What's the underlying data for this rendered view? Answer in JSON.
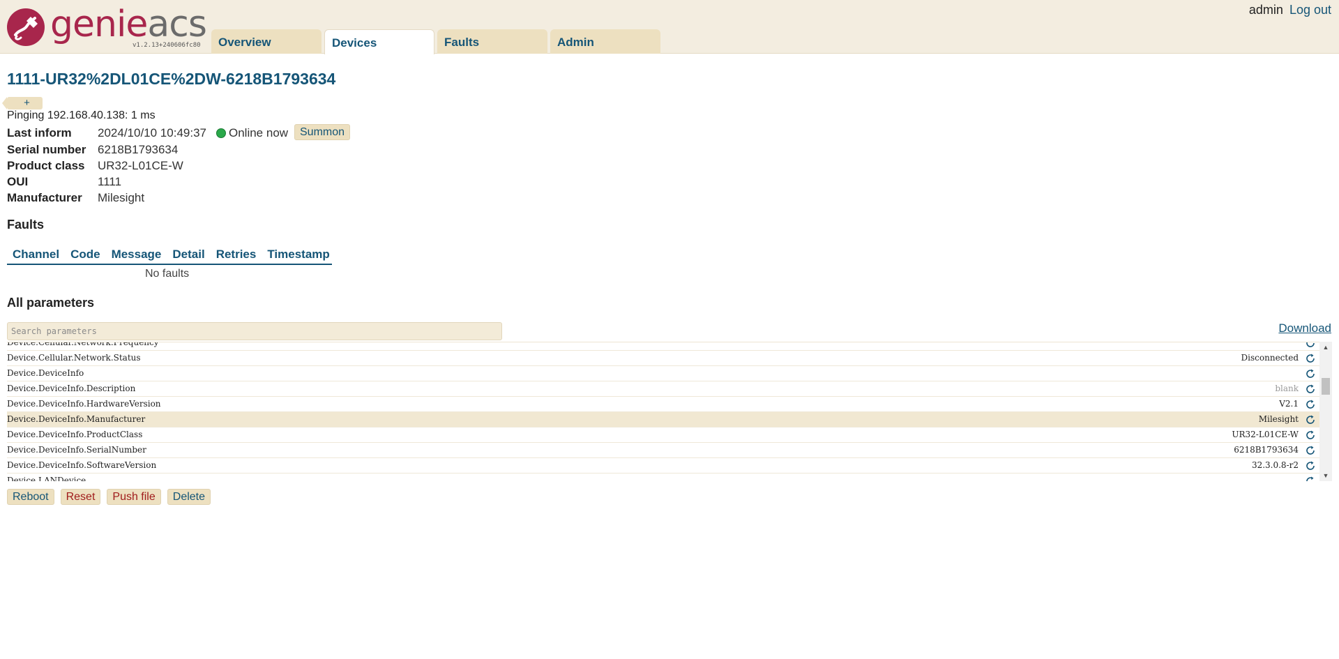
{
  "app": {
    "logo_prefix": "genie",
    "logo_suffix": "acs",
    "version": "v1.2.13+240606fc80"
  },
  "nav": {
    "tabs": [
      {
        "label": "Overview",
        "active": false
      },
      {
        "label": "Devices",
        "active": true
      },
      {
        "label": "Faults",
        "active": false
      },
      {
        "label": "Admin",
        "active": false
      }
    ]
  },
  "user": {
    "name": "admin",
    "logout_label": "Log out"
  },
  "device": {
    "title": "1111-UR32%2DL01CE%2DW-6218B1793634",
    "tag_add_label": "+",
    "ping": "Pinging 192.168.40.138: 1 ms",
    "last_inform_label": "Last inform",
    "last_inform_value": "2024/10/10 10:49:37",
    "online_status": "Online now",
    "summon_label": "Summon",
    "serial_label": "Serial number",
    "serial_value": "6218B1793634",
    "product_class_label": "Product class",
    "product_class_value": "UR32-L01CE-W",
    "oui_label": "OUI",
    "oui_value": "1111",
    "manufacturer_label": "Manufacturer",
    "manufacturer_value": "Milesight"
  },
  "faults": {
    "title": "Faults",
    "columns": [
      "Channel",
      "Code",
      "Message",
      "Detail",
      "Retries",
      "Timestamp"
    ],
    "empty_text": "No faults"
  },
  "parameters": {
    "title": "All parameters",
    "search_placeholder": "Search parameters",
    "download_label": "Download",
    "rows": [
      {
        "name": "Device.Cellular.Network.Frequency",
        "value": ""
      },
      {
        "name": "Device.Cellular.Network.Status",
        "value": "Disconnected"
      },
      {
        "name": "Device.DeviceInfo",
        "value": ""
      },
      {
        "name": "Device.DeviceInfo.Description",
        "value": "blank"
      },
      {
        "name": "Device.DeviceInfo.HardwareVersion",
        "value": "V2.1"
      },
      {
        "name": "Device.DeviceInfo.Manufacturer",
        "value": "Milesight"
      },
      {
        "name": "Device.DeviceInfo.ProductClass",
        "value": "UR32-L01CE-W"
      },
      {
        "name": "Device.DeviceInfo.SerialNumber",
        "value": "6218B1793634"
      },
      {
        "name": "Device.DeviceInfo.SoftwareVersion",
        "value": "32.3.0.8-r2"
      },
      {
        "name": "Device.LANDevice",
        "value": ""
      }
    ]
  },
  "actions": {
    "reboot": "Reboot",
    "reset": "Reset",
    "push_file": "Push file",
    "delete": "Delete"
  },
  "colors": {
    "header_bg": "#f3ede0",
    "brand": "#a8264c",
    "link": "#155577",
    "button_bg": "#ede0c0",
    "online": "#2aa84a"
  }
}
